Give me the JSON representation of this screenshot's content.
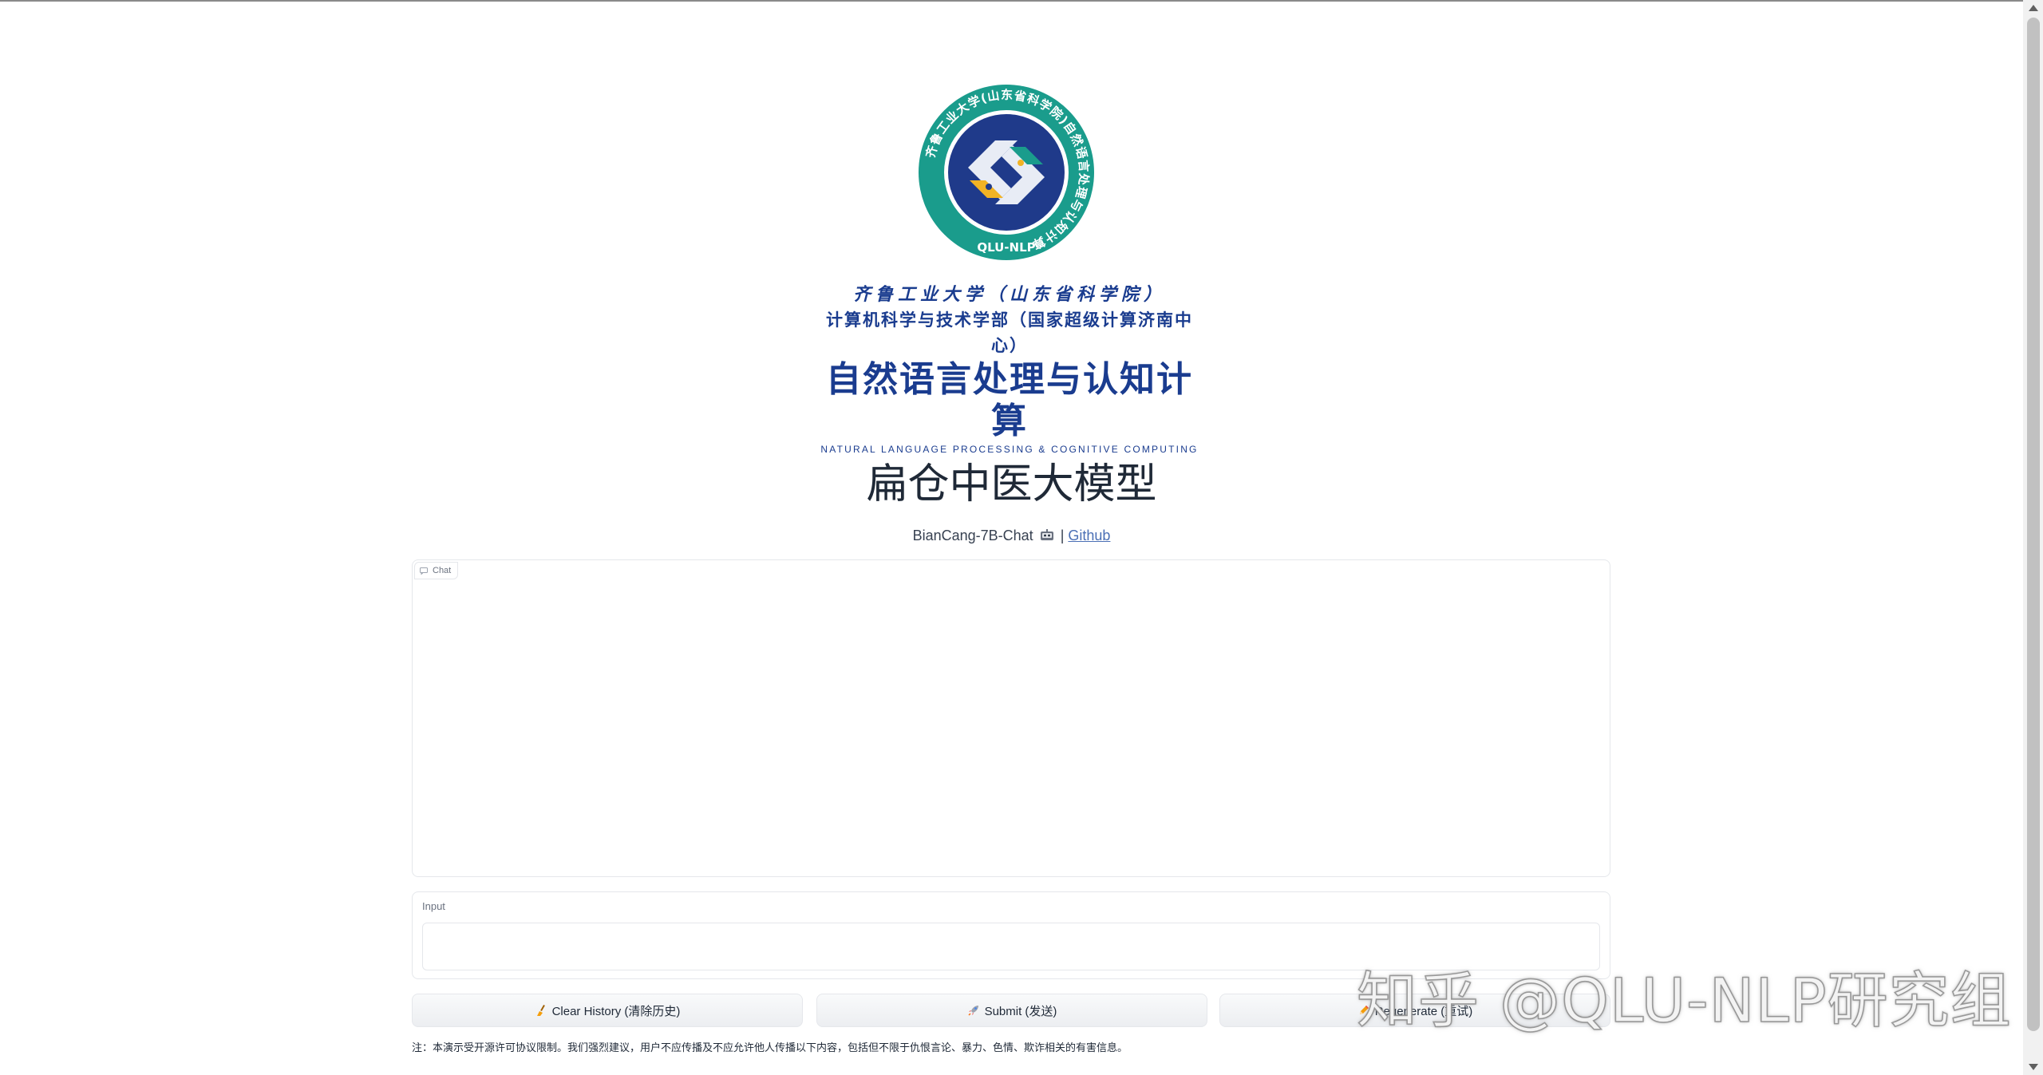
{
  "logo": {
    "ring_text": "齐鲁工业大学(山东省科学院)自然语言处理与认知计算",
    "badge_text": "QLU-NLP"
  },
  "brand": {
    "line1": "齐鲁工业大学（山东省科学院）",
    "line2": "计算机科学与技术学部（国家超级计算济南中心）",
    "line3": "自然语言处理与认知计算",
    "line4": "NATURAL LANGUAGE PROCESSING & COGNITIVE COMPUTING"
  },
  "header": {
    "title": "扁仓中医大模型",
    "subtitle_model": "BianCang-7B-Chat",
    "subtitle_sep": "|",
    "github_link": "Github"
  },
  "chat": {
    "label": "Chat"
  },
  "input": {
    "label": "Input",
    "value": "",
    "placeholder": ""
  },
  "buttons": {
    "clear": "Clear History (清除历史)",
    "submit": "Submit (发送)",
    "regenerate": "Regenerate (重试)"
  },
  "note": "注：本演示受开源许可协议限制。我们强烈建议，用户不应传播及不应允许他人传播以下内容，包括但不限于仇恨言论、暴力、色情、欺诈相关的有害信息。",
  "watermark": "知乎 @QLU-NLP研究组",
  "colors": {
    "brand_blue": "#1a3c8f",
    "logo_teal": "#1a9c8c",
    "logo_navy": "#1f3a8a",
    "logo_gold": "#f2b324",
    "link": "#4a6fb5"
  },
  "icons": {
    "chat": "chat-bubble-icon",
    "clear": "broom-icon",
    "submit": "rocket-icon",
    "regenerate": "pencil-icon",
    "robot": "robot-icon"
  }
}
